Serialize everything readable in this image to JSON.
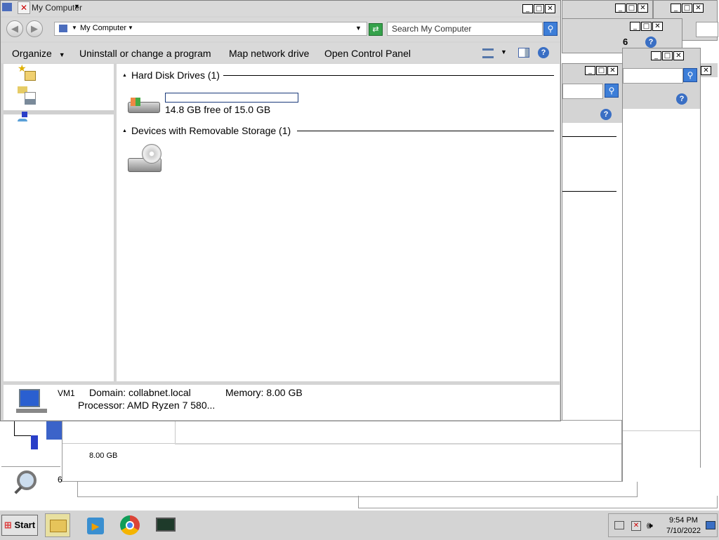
{
  "main_window": {
    "title": "My Computer",
    "address": "My Computer",
    "search_placeholder": "Search My Computer",
    "commands": [
      "Organize",
      "Uninstall or change a program",
      "Map network drive",
      "Open Control Panel"
    ],
    "groups": {
      "hdd_header": "Hard Disk Drives (1)",
      "hdd_free": "14.8 GB free of 15.0 GB",
      "removable_header": "Devices with Removable Storage (1)"
    },
    "details": {
      "computer_name": "VM1",
      "domain": "Domain: collabnet.local",
      "memory": "Memory: 8.00 GB",
      "processor": "Processor: AMD Ryzen 7 580..."
    }
  },
  "background_windows": {
    "number_label": "6",
    "memory_value": "8.00 GB",
    "partial_number": "6"
  },
  "taskbar": {
    "start_label": "Start",
    "time": "9:54 PM",
    "date": "7/10/2022"
  },
  "colors": {
    "accent": "#3d7ed8",
    "window_bg": "#d9d9d9",
    "taskbar_bg": "#d4d4d4"
  }
}
